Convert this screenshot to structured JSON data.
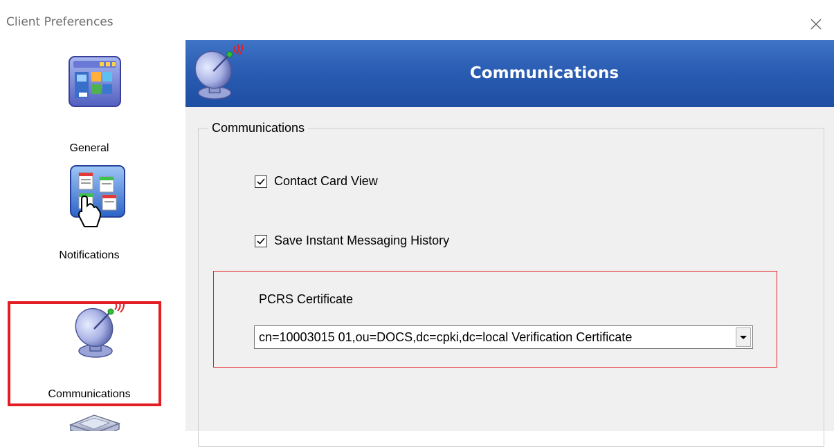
{
  "window": {
    "title": "Client Preferences",
    "close_icon": "close-icon"
  },
  "sidebar": {
    "items": [
      {
        "label": "General",
        "icon": "general-settings-icon",
        "selected": false
      },
      {
        "label": "Notifications",
        "icon": "notifications-icon",
        "selected": false
      },
      {
        "label": "Communications",
        "icon": "satellite-dish-icon",
        "selected": true
      },
      {
        "label": "",
        "icon": "scanner-icon",
        "selected": false
      }
    ],
    "highlight_color": "#e21d24"
  },
  "header": {
    "title": "Communications",
    "icon": "satellite-dish-icon",
    "color": "#2a5db3"
  },
  "content": {
    "group_title": "Communications",
    "contact_card_view": {
      "label": "Contact Card View",
      "checked": true
    },
    "save_im_history": {
      "label": "Save Instant Messaging History",
      "checked": true
    },
    "pcrs_certificate": {
      "label": "PCRS Certificate",
      "selected_value": "cn=10003015 01,ou=DOCS,dc=cpki,dc=local Verification Certificate"
    }
  }
}
